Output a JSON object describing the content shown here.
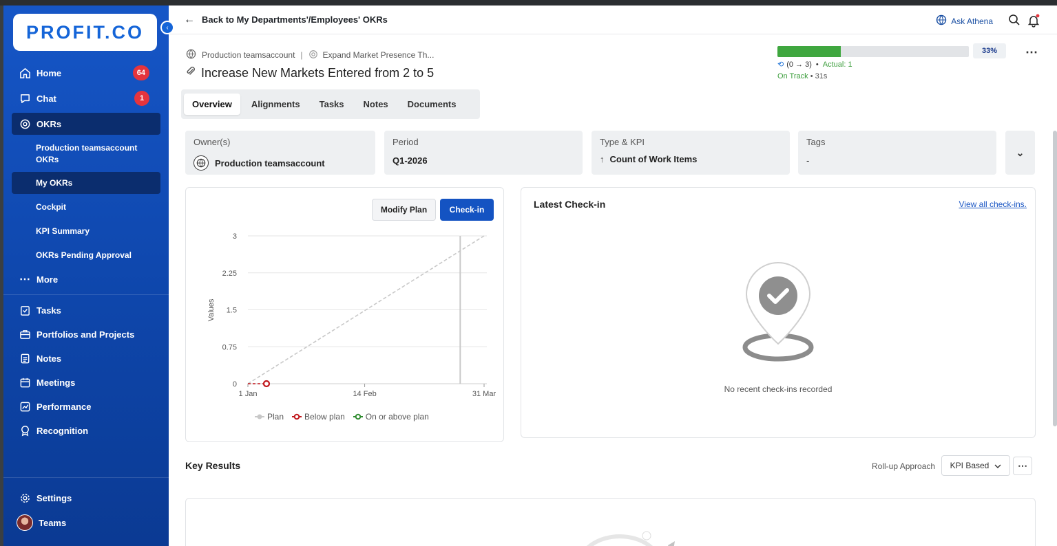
{
  "brand": {
    "logo_text": "PROFIT.CO",
    "accent": "#1565d8"
  },
  "sidebar": {
    "items": [
      {
        "label": "Home",
        "icon": "home-icon",
        "badge": "64"
      },
      {
        "label": "Chat",
        "icon": "chat-icon",
        "badge": "1"
      },
      {
        "label": "OKRs",
        "icon": "target-icon"
      },
      {
        "label": "More",
        "icon": "more-dots-icon"
      },
      {
        "label": "Tasks",
        "icon": "clipboard-check-icon"
      },
      {
        "label": "Portfolios and Projects",
        "icon": "briefcase-icon"
      },
      {
        "label": "Notes",
        "icon": "notes-icon"
      },
      {
        "label": "Meetings",
        "icon": "calendar-icon"
      },
      {
        "label": "Performance",
        "icon": "chart-line-icon"
      },
      {
        "label": "Recognition",
        "icon": "award-icon"
      },
      {
        "label": "Settings",
        "icon": "gear-icon"
      },
      {
        "label": "Teams",
        "icon": "avatar"
      }
    ],
    "okr_sub": [
      {
        "label": "Production teamsaccount OKRs"
      },
      {
        "label": "My OKRs"
      },
      {
        "label": "Cockpit"
      },
      {
        "label": "KPI Summary"
      },
      {
        "label": "OKRs Pending Approval"
      }
    ]
  },
  "header": {
    "back_label": "Back to My Departments'/Employees' OKRs",
    "ask_athena": "Ask Athena"
  },
  "objective": {
    "owner_crumb": "Production teamsaccount",
    "parent_crumb": "Expand Market Presence Th...",
    "title": "Increase New Markets Entered from 2 to 5",
    "progress_pct": "33%",
    "progress_value": 0.33,
    "range_text": "(0 → 3)",
    "actual_text": "Actual: 1",
    "status": "On Track",
    "status_age": "31s"
  },
  "tabs": [
    {
      "label": "Overview"
    },
    {
      "label": "Alignments"
    },
    {
      "label": "Tasks"
    },
    {
      "label": "Notes"
    },
    {
      "label": "Documents"
    }
  ],
  "details": {
    "owner_label": "Owner(s)",
    "owner_value": "Production teamsaccount",
    "period_label": "Period",
    "period_value": "Q1-2026",
    "type_label": "Type & KPI",
    "type_value": "Count of Work Items",
    "tags_label": "Tags",
    "tags_value": "-"
  },
  "chart_panel": {
    "modify_label": "Modify Plan",
    "checkin_label": "Check-in"
  },
  "chart_data": {
    "type": "line",
    "ylabel": "Values",
    "xlabel": "",
    "x_ticks": [
      "1 Jan",
      "14 Feb",
      "31 Mar"
    ],
    "y_ticks": [
      "0",
      "0.75",
      "1.5",
      "2.25",
      "3"
    ],
    "ylim": [
      0,
      3
    ],
    "x_range_days": [
      0,
      89
    ],
    "series": [
      {
        "name": "Plan",
        "color": "#c8c8c8",
        "points": [
          [
            0,
            0
          ],
          [
            89,
            3
          ]
        ]
      },
      {
        "name": "Below plan",
        "color": "#c0161b",
        "points": [
          [
            0,
            0
          ],
          [
            7,
            0
          ]
        ]
      },
      {
        "name": "On or above plan",
        "color": "#2e8b2e",
        "points": []
      }
    ],
    "current_marker_day": 80,
    "legend_position": "bottom"
  },
  "latest_checkin": {
    "title": "Latest Check-in",
    "link": "View all check-ins.",
    "empty_text": "No recent check-ins recorded"
  },
  "key_results": {
    "title": "Key Results",
    "rollup_label": "Roll-up Approach",
    "rollup_value": "KPI Based"
  }
}
